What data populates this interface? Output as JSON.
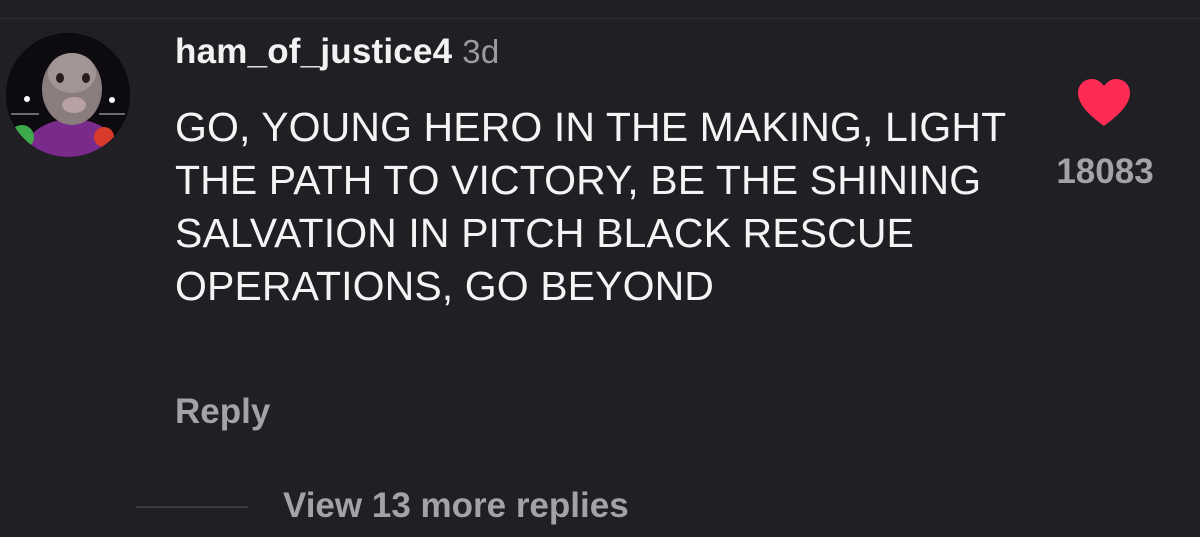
{
  "comment": {
    "username": "ham_of_justice4",
    "timestamp": "3d",
    "text": "GO, YOUNG HERO IN THE MAKING, LIGHT THE PATH TO VICTORY, BE THE SHINING SALVATION IN PITCH BLACK RESCUE OPERATIONS, GO BEYOND",
    "reply_label": "Reply",
    "like_count": "18083",
    "liked": true
  },
  "replies": {
    "view_more_label": "View 13 more replies"
  },
  "colors": {
    "background": "#1f1f24",
    "heart": "#fe2c55",
    "muted_text": "#a2a2a8",
    "primary_text": "#f4f4f4"
  },
  "icons": {
    "like": "heart-icon"
  }
}
